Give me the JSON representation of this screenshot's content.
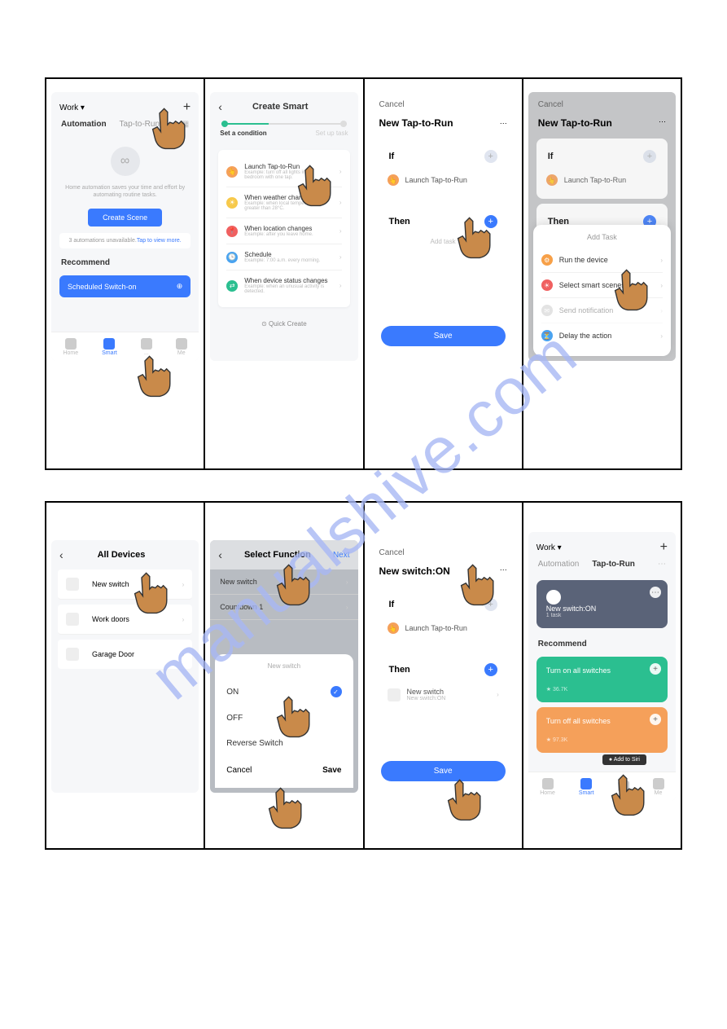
{
  "watermark": "manualshive.com",
  "s1": {
    "location": "Work ▾",
    "tab_automation": "Automation",
    "tab_taptorun": "Tap-to-Run",
    "blurb": "Home automation saves your time and effort by automating routine tasks.",
    "create_scene": "Create Scene",
    "avail_pre": "3 automations unavailable.",
    "avail_link": "Tap to view more.",
    "recommend": "Recommend",
    "sched_bar": "Scheduled Switch-on",
    "nav_home": "Home",
    "nav_smart": "Smart",
    "nav_c": "...",
    "nav_me": "Me"
  },
  "s2": {
    "title": "Create Smart",
    "step_a": "Set a condition",
    "step_b": "Set up task",
    "items": [
      {
        "color": "#f5a05a",
        "t": "Launch Tap-to-Run",
        "s": "Example: turn off all lights in the bedroom with one tap."
      },
      {
        "color": "#f7c94b",
        "t": "When weather changes",
        "s": "Example: when local temperature is greater than 28°C."
      },
      {
        "color": "#f06060",
        "t": "When location changes",
        "s": "Example: after you leave home."
      },
      {
        "color": "#4aa3f0",
        "t": "Schedule",
        "s": "Example: 7:00 a.m. every morning."
      },
      {
        "color": "#2bbf90",
        "t": "When device status changes",
        "s": "Example: when an unusual activity is detected."
      }
    ],
    "quick": "⊙ Quick Create"
  },
  "s3": {
    "cancel": "Cancel",
    "title": "New Tap-to-Run",
    "if": "If",
    "launch": "Launch Tap-to-Run",
    "then": "Then",
    "add_task": "Add task",
    "save": "Save"
  },
  "s4": {
    "cancel": "Cancel",
    "title": "New Tap-to-Run",
    "if": "If",
    "launch": "Launch Tap-to-Run",
    "then": "Then",
    "add_task": "Add task",
    "sheet_title": "Add Task",
    "opts": [
      {
        "c": "#f7a048",
        "t": "Run the device"
      },
      {
        "c": "#f06060",
        "t": "Select smart scenes"
      },
      {
        "c": "#bbb",
        "t": "Send notification"
      },
      {
        "c": "#4aa3f0",
        "t": "Delay the action"
      }
    ]
  },
  "s5": {
    "title": "All Devices",
    "devs": [
      "New switch",
      "Work doors",
      "Garage Door"
    ]
  },
  "s6": {
    "title": "Select Function",
    "next": "Next",
    "fns": [
      "New switch",
      "Countdown 1"
    ],
    "sheet_title": "New switch",
    "on": "ON",
    "off": "OFF",
    "rev": "Reverse Switch",
    "cancel": "Cancel",
    "save": "Save"
  },
  "s7": {
    "cancel": "Cancel",
    "title": "New switch:ON",
    "if": "If",
    "launch": "Launch Tap-to-Run",
    "then": "Then",
    "dev": "New switch",
    "dev_sub": "New switch:ON",
    "save": "Save"
  },
  "s8": {
    "location": "Work ▾",
    "tab_automation": "Automation",
    "tab_taptorun": "Tap-to-Run",
    "card_title": "New switch:ON",
    "card_sub": "1 task",
    "recommend": "Recommend",
    "rec1": "Turn on all switches",
    "rec1_meta": "36.7K",
    "rec2": "Turn off all switches",
    "rec2_meta": "97.3K",
    "add_siri": "● Add to Siri",
    "nav_home": "Home",
    "nav_smart": "Smart",
    "nav_me": "Me"
  }
}
